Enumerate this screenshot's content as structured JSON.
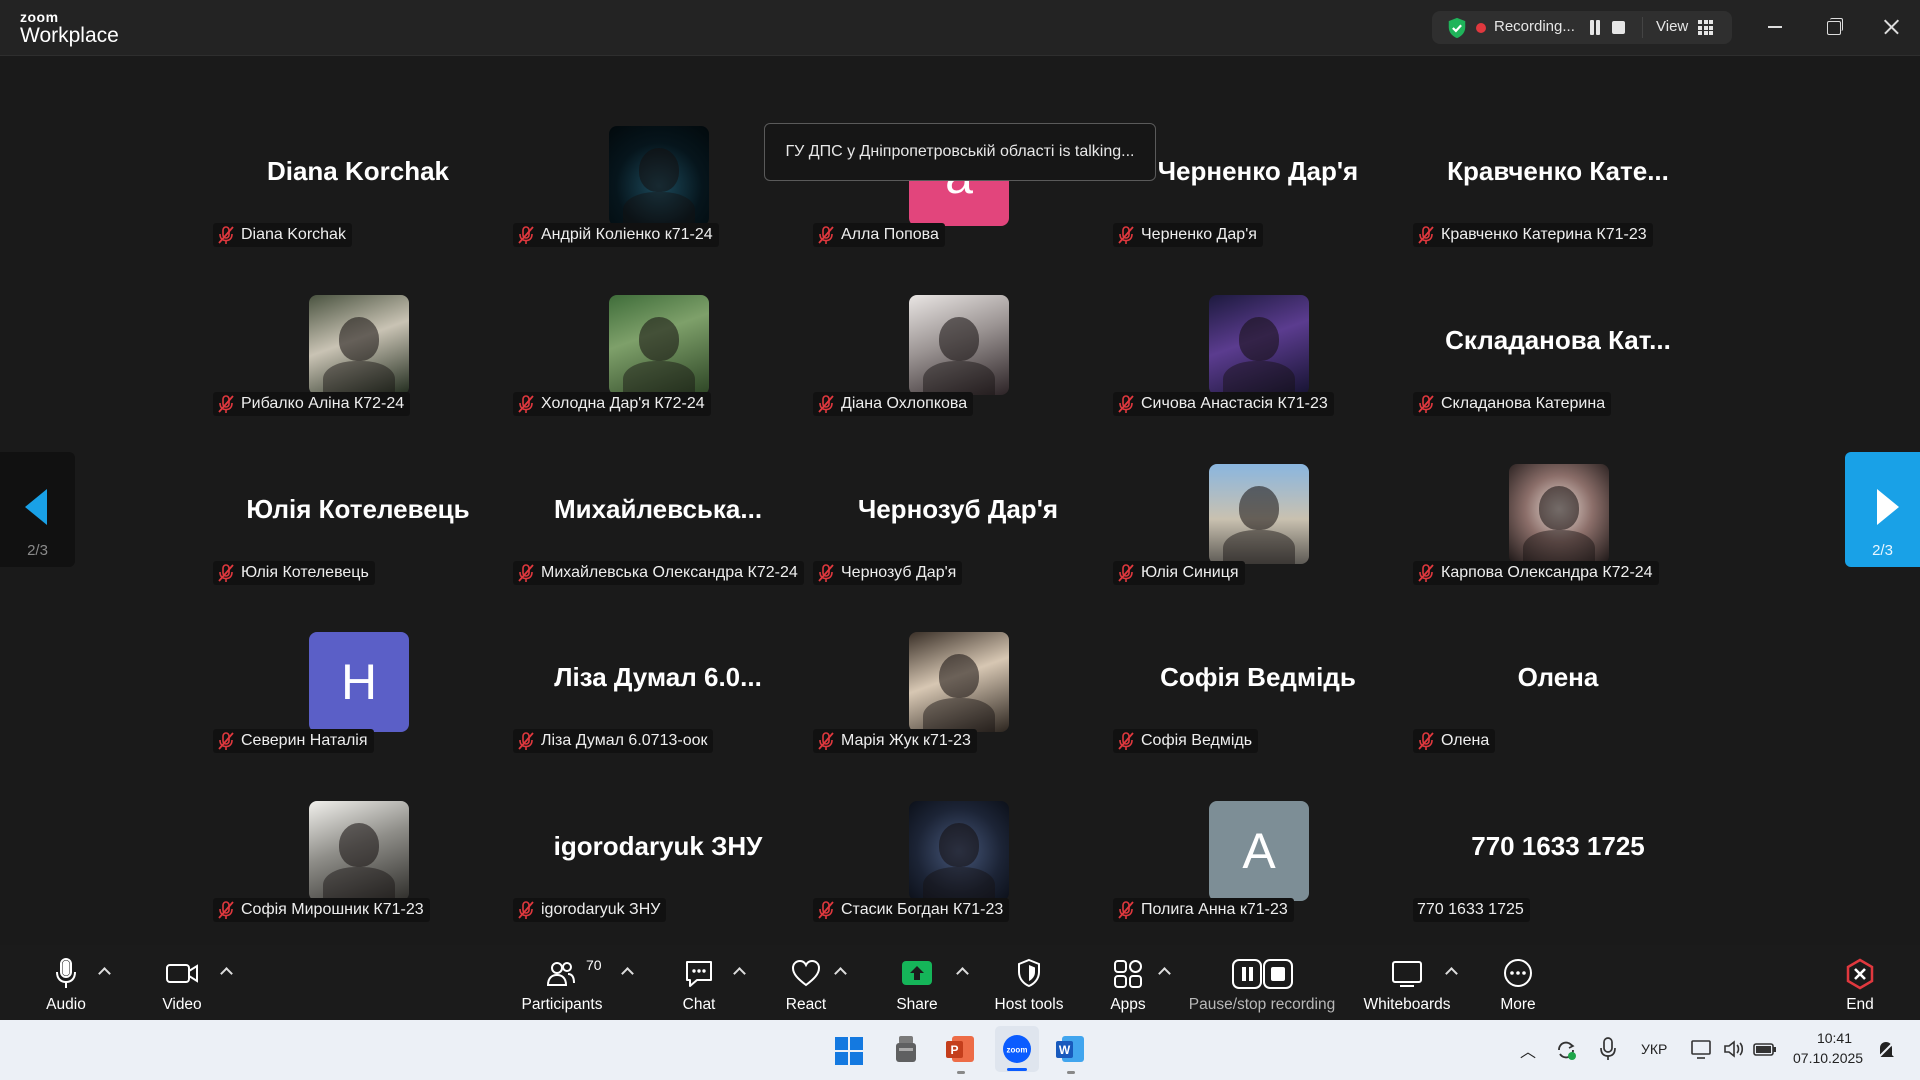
{
  "app": {
    "logo_top": "zoom",
    "logo_bottom": "Workplace"
  },
  "recording_bar": {
    "status": "Recording...",
    "view_label": "View"
  },
  "talking_banner": "ГУ ДПС у Дніпропетровській області is talking...",
  "pagination": {
    "left": "2/3",
    "right": "2/3"
  },
  "tiles": [
    {
      "big_name": "Diana Korchak",
      "label": "Diana Korchak",
      "muted": true
    },
    {
      "avatar": "photo",
      "label": "Андрій Коліенко  к71-24",
      "muted": true
    },
    {
      "letter": "a",
      "letter_color": "#e2457c",
      "label": "Алла Попова",
      "muted": true
    },
    {
      "big_name": "Черненко Дар'я",
      "label": "Черненко Дар'я",
      "muted": true
    },
    {
      "big_name": "Кравченко  Кате...",
      "label": "Кравченко Катерина К71-23",
      "muted": true
    },
    {
      "avatar": "photo",
      "label": "Рибалко Аліна К72-24",
      "muted": true
    },
    {
      "avatar": "photo",
      "label": "Холодна Дар'я К72-24",
      "muted": true
    },
    {
      "avatar": "photo",
      "label": "Діана Охлопкова",
      "muted": true
    },
    {
      "avatar": "photo",
      "label": "Сичова Анастасія К71-23",
      "muted": true
    },
    {
      "big_name": "Складанова  Кат...",
      "label": "Складанова Катерина",
      "muted": true
    },
    {
      "big_name": "Юлія Котелевець",
      "label": "Юлія Котелевець",
      "muted": true
    },
    {
      "big_name": "Михайлевська...",
      "label": "Михайлевська Олександра К72-24",
      "muted": true
    },
    {
      "big_name": "Чернозуб Дар'я",
      "label": "Чернозуб Дар'я",
      "muted": true
    },
    {
      "avatar": "photo",
      "label": "Юлія Синиця",
      "muted": true
    },
    {
      "avatar": "photo",
      "label": "Карпова Олександра К72-24",
      "muted": true
    },
    {
      "letter": "H",
      "letter_color": "#5b5fc7",
      "label": "Северин Наталія",
      "muted": true
    },
    {
      "big_name": "Ліза Думал 6.0...",
      "label": "Ліза Думал 6.0713-оок",
      "muted": true
    },
    {
      "avatar": "photo",
      "label": "Марія Жук к71-23",
      "muted": true
    },
    {
      "big_name": "Софія Ведмідь",
      "label": "Софія Ведмідь",
      "muted": true
    },
    {
      "big_name": "Олена",
      "label": "Олена",
      "muted": true
    },
    {
      "avatar": "photo",
      "label": "Софія Мирошник К71-23",
      "muted": true
    },
    {
      "big_name": "igorodaryuk ЗНУ",
      "label": "igorodaryuk ЗНУ",
      "muted": true
    },
    {
      "avatar": "photo",
      "label": "Стасик Богдан К71-23",
      "muted": true
    },
    {
      "letter": "A",
      "letter_color": "#7d8e96",
      "label": "Полига Анна к71-23",
      "muted": true
    },
    {
      "big_name": "770 1633 1725",
      "label": "770 1633 1725",
      "muted": false
    }
  ],
  "toolbar": {
    "audio": "Audio",
    "video": "Video",
    "participants": "Participants",
    "participants_count": "70",
    "chat": "Chat",
    "react": "React",
    "share": "Share",
    "host_tools": "Host tools",
    "apps": "Apps",
    "pause_stop": "Pause/stop recording",
    "whiteboards": "Whiteboards",
    "more": "More",
    "end": "End"
  },
  "taskbar": {
    "lang": "УКР",
    "time": "10:41",
    "date": "07.10.2025"
  },
  "colors": {
    "accent": "#19a1e7",
    "share_green": "#15b559",
    "end_red": "#e0383e",
    "muted_red": "#e0383e"
  }
}
